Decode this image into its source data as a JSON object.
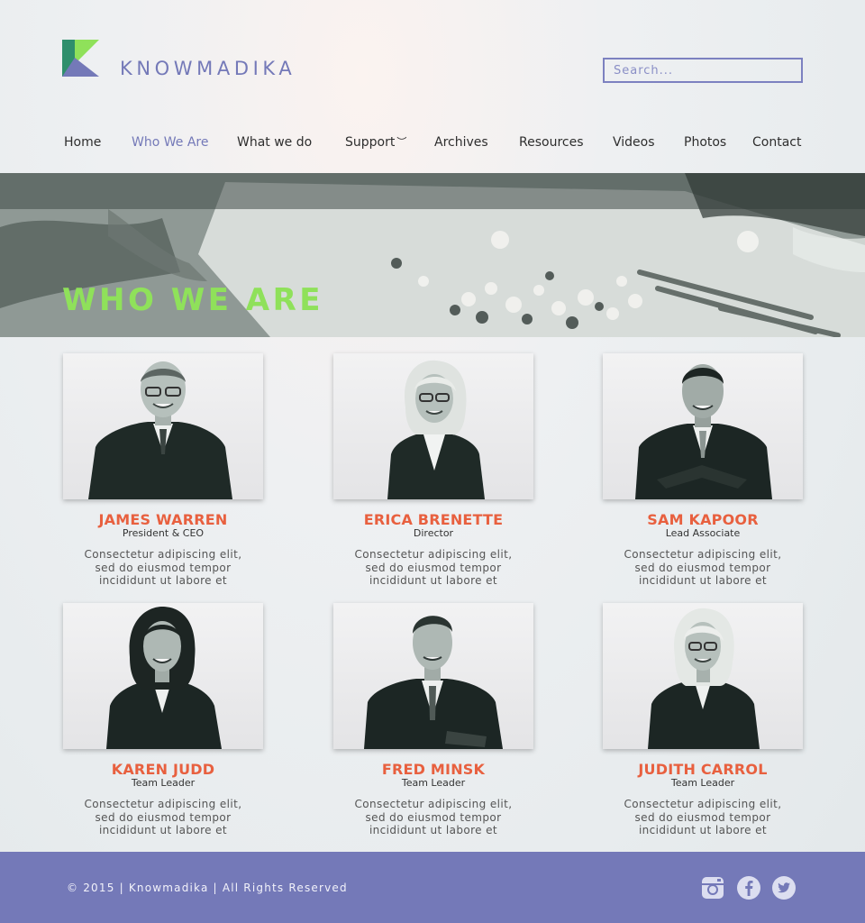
{
  "brand": {
    "name": "KNOWMADIKA",
    "logo_icon": "k-logo-icon",
    "colors": {
      "accent": "#7479b8",
      "green": "#8fe15a",
      "orange": "#e8603f"
    }
  },
  "search": {
    "placeholder": "Search..."
  },
  "nav": {
    "items": [
      {
        "label": "Home",
        "active": false
      },
      {
        "label": "Who We Are",
        "active": true
      },
      {
        "label": "What we do",
        "active": false
      },
      {
        "label": "Support",
        "active": false,
        "dropdown": true
      },
      {
        "label": "Archives",
        "active": false
      },
      {
        "label": "Resources",
        "active": false
      },
      {
        "label": "Videos",
        "active": false
      },
      {
        "label": "Photos",
        "active": false
      },
      {
        "label": "Contact",
        "active": false
      }
    ]
  },
  "hero": {
    "title": "WHO WE ARE"
  },
  "team": [
    {
      "name": "JAMES WARREN",
      "role": "President & CEO",
      "bio": "Consectetur adipiscing elit,\nsed do eiusmod tempor\nincididunt ut labore et"
    },
    {
      "name": "ERICA BRENETTE",
      "role": "Director",
      "bio": "Consectetur adipiscing elit,\nsed do eiusmod tempor\nincididunt ut labore et"
    },
    {
      "name": "SAM KAPOOR",
      "role": "Lead Associate",
      "bio": "Consectetur adipiscing elit,\nsed do eiusmod tempor\nincididunt ut labore et"
    },
    {
      "name": "KAREN JUDD",
      "role": "Team Leader",
      "bio": "Consectetur adipiscing elit,\nsed do eiusmod tempor\nincididunt ut labore et"
    },
    {
      "name": "FRED MINSK",
      "role": "Team Leader",
      "bio": "Consectetur adipiscing elit,\nsed do eiusmod tempor\nincididunt ut labore et"
    },
    {
      "name": "JUDITH CARROL",
      "role": "Team Leader",
      "bio": "Consectetur adipiscing elit,\nsed do eiusmod tempor\nincididunt ut labore et"
    }
  ],
  "footer": {
    "copyright": "© 2015 | Knowmadika | All Rights Reserved",
    "social": [
      "instagram-icon",
      "facebook-icon",
      "twitter-icon"
    ]
  }
}
